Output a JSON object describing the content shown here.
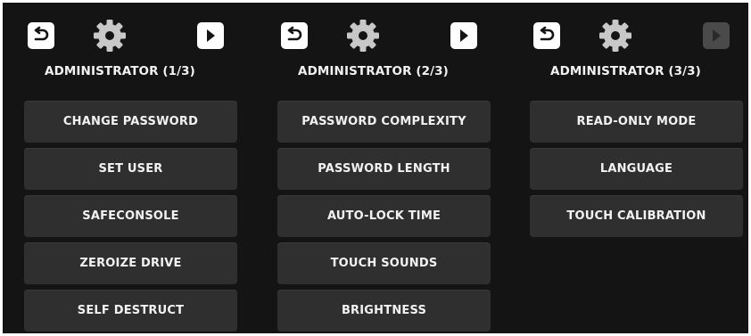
{
  "panels": [
    {
      "title": "ADMINISTRATOR (1/3)",
      "back_icon": "back-arrow-icon",
      "settings_icon": "gear-icon",
      "next_icon": "play-arrow-icon",
      "next_enabled": true,
      "items": [
        "CHANGE PASSWORD",
        "SET USER",
        "SAFECONSOLE",
        "ZEROIZE DRIVE",
        "SELF DESTRUCT"
      ]
    },
    {
      "title": "ADMINISTRATOR (2/3)",
      "back_icon": "back-arrow-icon",
      "settings_icon": "gear-icon",
      "next_icon": "play-arrow-icon",
      "next_enabled": true,
      "items": [
        "PASSWORD COMPLEXITY",
        "PASSWORD LENGTH",
        "AUTO-LOCK TIME",
        "TOUCH SOUNDS",
        "BRIGHTNESS"
      ]
    },
    {
      "title": "ADMINISTRATOR (3/3)",
      "back_icon": "back-arrow-icon",
      "settings_icon": "gear-icon",
      "next_icon": "play-arrow-icon",
      "next_enabled": false,
      "items": [
        "READ-ONLY MODE",
        "LANGUAGE",
        "TOUCH CALIBRATION"
      ]
    }
  ],
  "colors": {
    "background": "#141414",
    "button": "#2f2f2f",
    "text": "#f2f2f2",
    "icon": "#ffffff",
    "gear": "#c8c8c8",
    "disabled": "#4a4a4a"
  }
}
